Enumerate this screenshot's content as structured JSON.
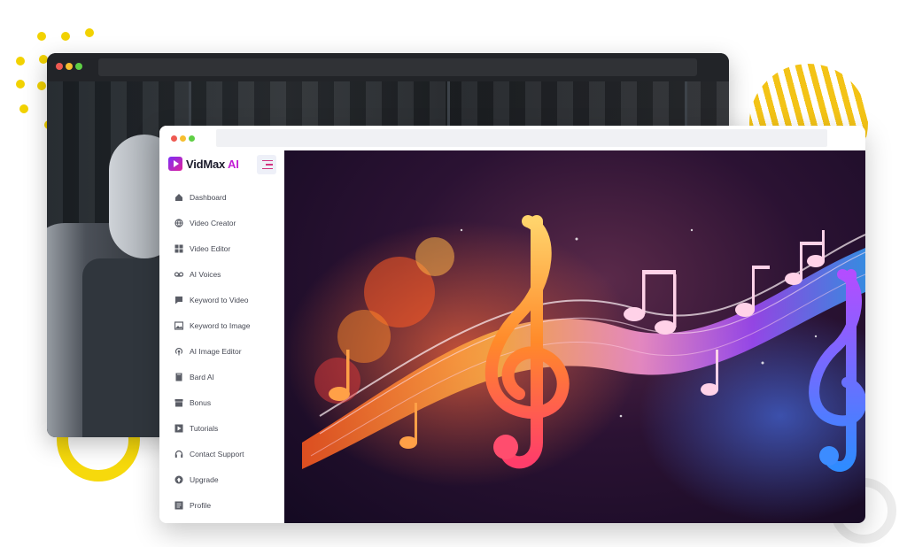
{
  "app": {
    "brand_name": "VidMax",
    "brand_suffix": "AI"
  },
  "colors": {
    "accent": "#c31fd6",
    "toggle_lines": "#d2337f",
    "window_dot_red": "#ee5a52",
    "window_dot_yellow": "#f6be2f",
    "window_dot_green": "#5fcf45",
    "deco_yellow": "#f6d90c"
  },
  "sidebar": {
    "items": [
      {
        "label": "Dashboard",
        "icon": "home-icon"
      },
      {
        "label": "Video Creator",
        "icon": "globe-icon"
      },
      {
        "label": "Video Editor",
        "icon": "grid-icon"
      },
      {
        "label": "AI Voices",
        "icon": "voicemail-icon"
      },
      {
        "label": "Keyword to Video",
        "icon": "chat-icon"
      },
      {
        "label": "Keyword to Image",
        "icon": "image-icon"
      },
      {
        "label": "AI Image Editor",
        "icon": "broadcast-icon"
      },
      {
        "label": "Bard AI",
        "icon": "book-icon"
      },
      {
        "label": "Bonus",
        "icon": "gift-icon"
      },
      {
        "label": "Tutorials",
        "icon": "play-icon"
      },
      {
        "label": "Contact Support",
        "icon": "headset-icon"
      },
      {
        "label": "Upgrade",
        "icon": "upgrade-icon"
      },
      {
        "label": "Profile",
        "icon": "profile-icon"
      }
    ]
  }
}
